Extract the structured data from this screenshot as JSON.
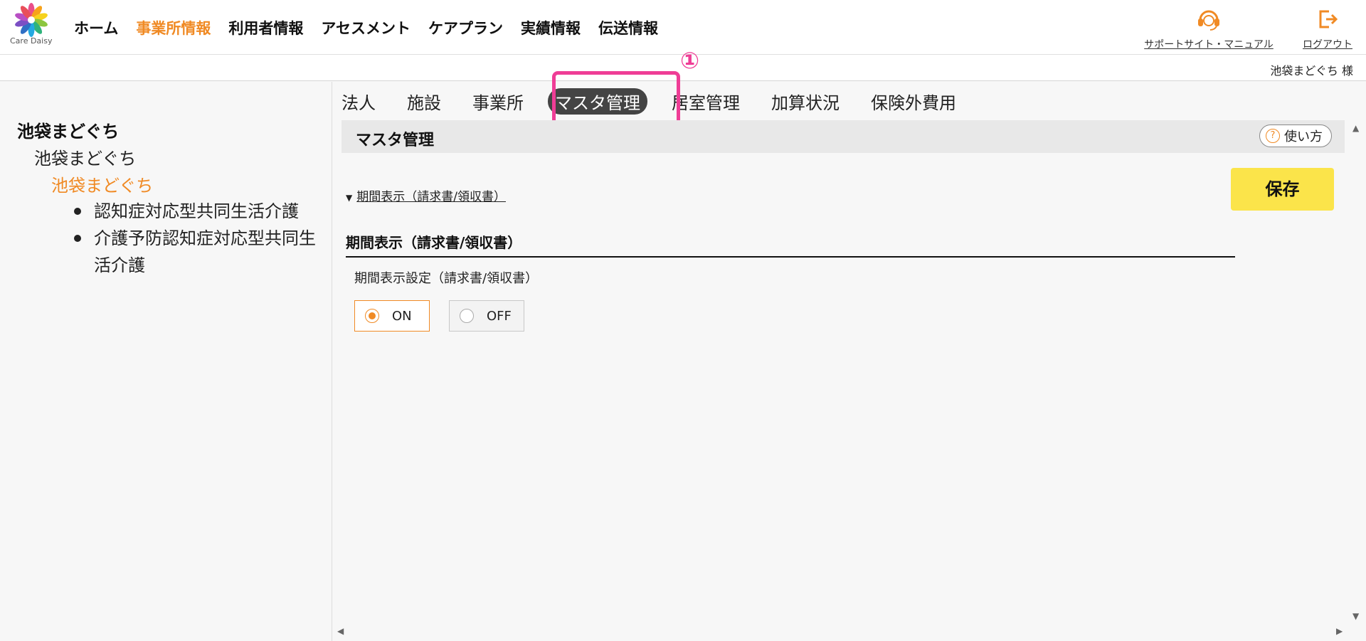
{
  "app": {
    "logo_text": "Care Daisy"
  },
  "nav": {
    "items": [
      {
        "label": "ホーム",
        "active": false
      },
      {
        "label": "事業所情報",
        "active": true
      },
      {
        "label": "利用者情報",
        "active": false
      },
      {
        "label": "アセスメント",
        "active": false
      },
      {
        "label": "ケアプラン",
        "active": false
      },
      {
        "label": "実績情報",
        "active": false
      },
      {
        "label": "伝送情報",
        "active": false
      }
    ],
    "support_label": "サポートサイト・マニュアル",
    "logout_label": "ログアウト"
  },
  "user": {
    "name": "池袋まどぐち 様"
  },
  "tree": {
    "corporation": "池袋まどぐち",
    "facility": "池袋まどぐち",
    "office": "池袋まどぐち",
    "services": [
      "認知症対応型共同生活介護",
      "介護予防認知症対応型共同生活介護"
    ]
  },
  "tabs": [
    "法人",
    "施設",
    "事業所",
    "マスタ管理",
    "居室管理",
    "加算状況",
    "保険外費用"
  ],
  "active_tab": "マスタ管理",
  "annotation": {
    "number": "①",
    "color": "#ef3d96"
  },
  "section": {
    "title": "マスタ管理",
    "help_label": "使い方",
    "help_icon": "?",
    "save_label": "保存",
    "collapse_link": "期間表示（請求書/領収書）",
    "group_title": "期間表示（請求書/領収書）",
    "field_label": "期間表示設定（請求書/領収書）",
    "options": [
      {
        "label": "ON",
        "selected": true
      },
      {
        "label": "OFF",
        "selected": false
      }
    ]
  },
  "colors": {
    "accent": "#f08a24",
    "save": "#fbe44a",
    "tab_active_bg": "#444444"
  }
}
